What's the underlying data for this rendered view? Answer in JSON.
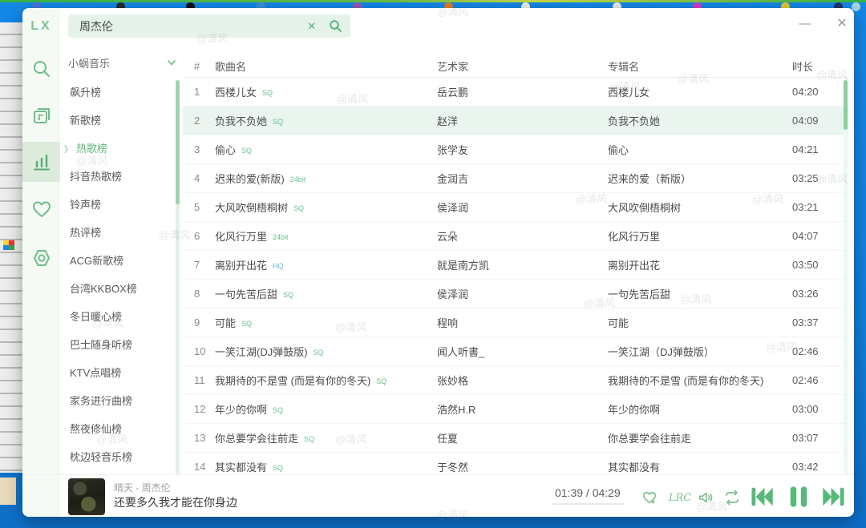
{
  "window_controls": {
    "minimize": "—",
    "close": "✕"
  },
  "logo": "LX",
  "search": {
    "value": "周杰伦",
    "clear": "✕"
  },
  "source_select": {
    "value": "小蜗音乐"
  },
  "boards": {
    "active_index": 2,
    "active_arrow": "〉",
    "items": [
      "飙升榜",
      "新歌榜",
      "热歌榜",
      "抖音热歌榜",
      "铃声榜",
      "热评榜",
      "ACG新歌榜",
      "台湾KKBOX榜",
      "冬日暖心榜",
      "巴士随身听榜",
      "KTV点唱榜",
      "家务进行曲榜",
      "熬夜修仙榜",
      "枕边轻音乐榜"
    ]
  },
  "table": {
    "headers": {
      "num": "#",
      "song": "歌曲名",
      "artist": "艺术家",
      "album": "专辑名",
      "duration": "时长"
    },
    "rows": [
      {
        "num": "1",
        "song": "西楼儿女",
        "tag": "SQ",
        "artist": "岳云鹏",
        "album": "西楼儿女",
        "duration": "04:20",
        "highlight": false
      },
      {
        "num": "2",
        "song": "负我不负她",
        "tag": "SQ",
        "artist": "赵洋",
        "album": "负我不负她",
        "duration": "04:09",
        "highlight": true
      },
      {
        "num": "3",
        "song": "偷心",
        "tag": "SQ",
        "artist": "张学友",
        "album": "偷心",
        "duration": "04:21",
        "highlight": false
      },
      {
        "num": "4",
        "song": "迟来的爱(新版)",
        "tag": "24bit",
        "artist": "金润吉",
        "album": "迟来的爱（新版）",
        "duration": "03:25",
        "highlight": false
      },
      {
        "num": "5",
        "song": "大风吹倒梧桐树",
        "tag": "SQ",
        "artist": "侯泽润",
        "album": "大风吹倒梧桐树",
        "duration": "03:21",
        "highlight": false
      },
      {
        "num": "6",
        "song": "化风行万里",
        "tag": "24bit",
        "artist": "云朵",
        "album": "化风行万里",
        "duration": "04:07",
        "highlight": false
      },
      {
        "num": "7",
        "song": "离别开出花",
        "tag": "HQ",
        "artist": "就是南方凯",
        "album": "离别开出花",
        "duration": "03:50",
        "highlight": false
      },
      {
        "num": "8",
        "song": "一句先苦后甜",
        "tag": "SQ",
        "artist": "侯泽润",
        "album": "一句先苦后甜",
        "duration": "03:26",
        "highlight": false
      },
      {
        "num": "9",
        "song": "可能",
        "tag": "SQ",
        "artist": "程响",
        "album": "可能",
        "duration": "03:37",
        "highlight": false
      },
      {
        "num": "10",
        "song": "一笑江湖(DJ弹鼓版)",
        "tag": "SQ",
        "artist": "闻人听書_",
        "album": "一笑江湖（DJ弹鼓版）",
        "duration": "02:46",
        "highlight": false
      },
      {
        "num": "11",
        "song": "我期待的不是雪 (而是有你的冬天)",
        "tag": "SQ",
        "artist": "张妙格",
        "album": "我期待的不是雪 (而是有你的冬天)",
        "duration": "02:46",
        "highlight": false
      },
      {
        "num": "12",
        "song": "年少的你啊",
        "tag": "SQ",
        "artist": "浩然H.R",
        "album": "年少的你啊",
        "duration": "03:00",
        "highlight": false
      },
      {
        "num": "13",
        "song": "你总要学会往前走",
        "tag": "SQ",
        "artist": "任夏",
        "album": "你总要学会往前走",
        "duration": "03:07",
        "highlight": false
      },
      {
        "num": "14",
        "song": "其实都没有",
        "tag": "SQ",
        "artist": "于冬然",
        "album": "其实都没有",
        "duration": "03:42",
        "highlight": false
      }
    ]
  },
  "player": {
    "title": "晴天 - 周杰伦",
    "lyric": "还要多久我才能在你身边",
    "time": "01:39 / 04:29",
    "lrc_label": "LRC"
  },
  "watermark": "@清风",
  "colors": {
    "accent_green": "#5fb878",
    "tag_green": "#67c08b",
    "tag_blue": "#6cb3e0",
    "row_highlight": "#e9f5ee"
  }
}
